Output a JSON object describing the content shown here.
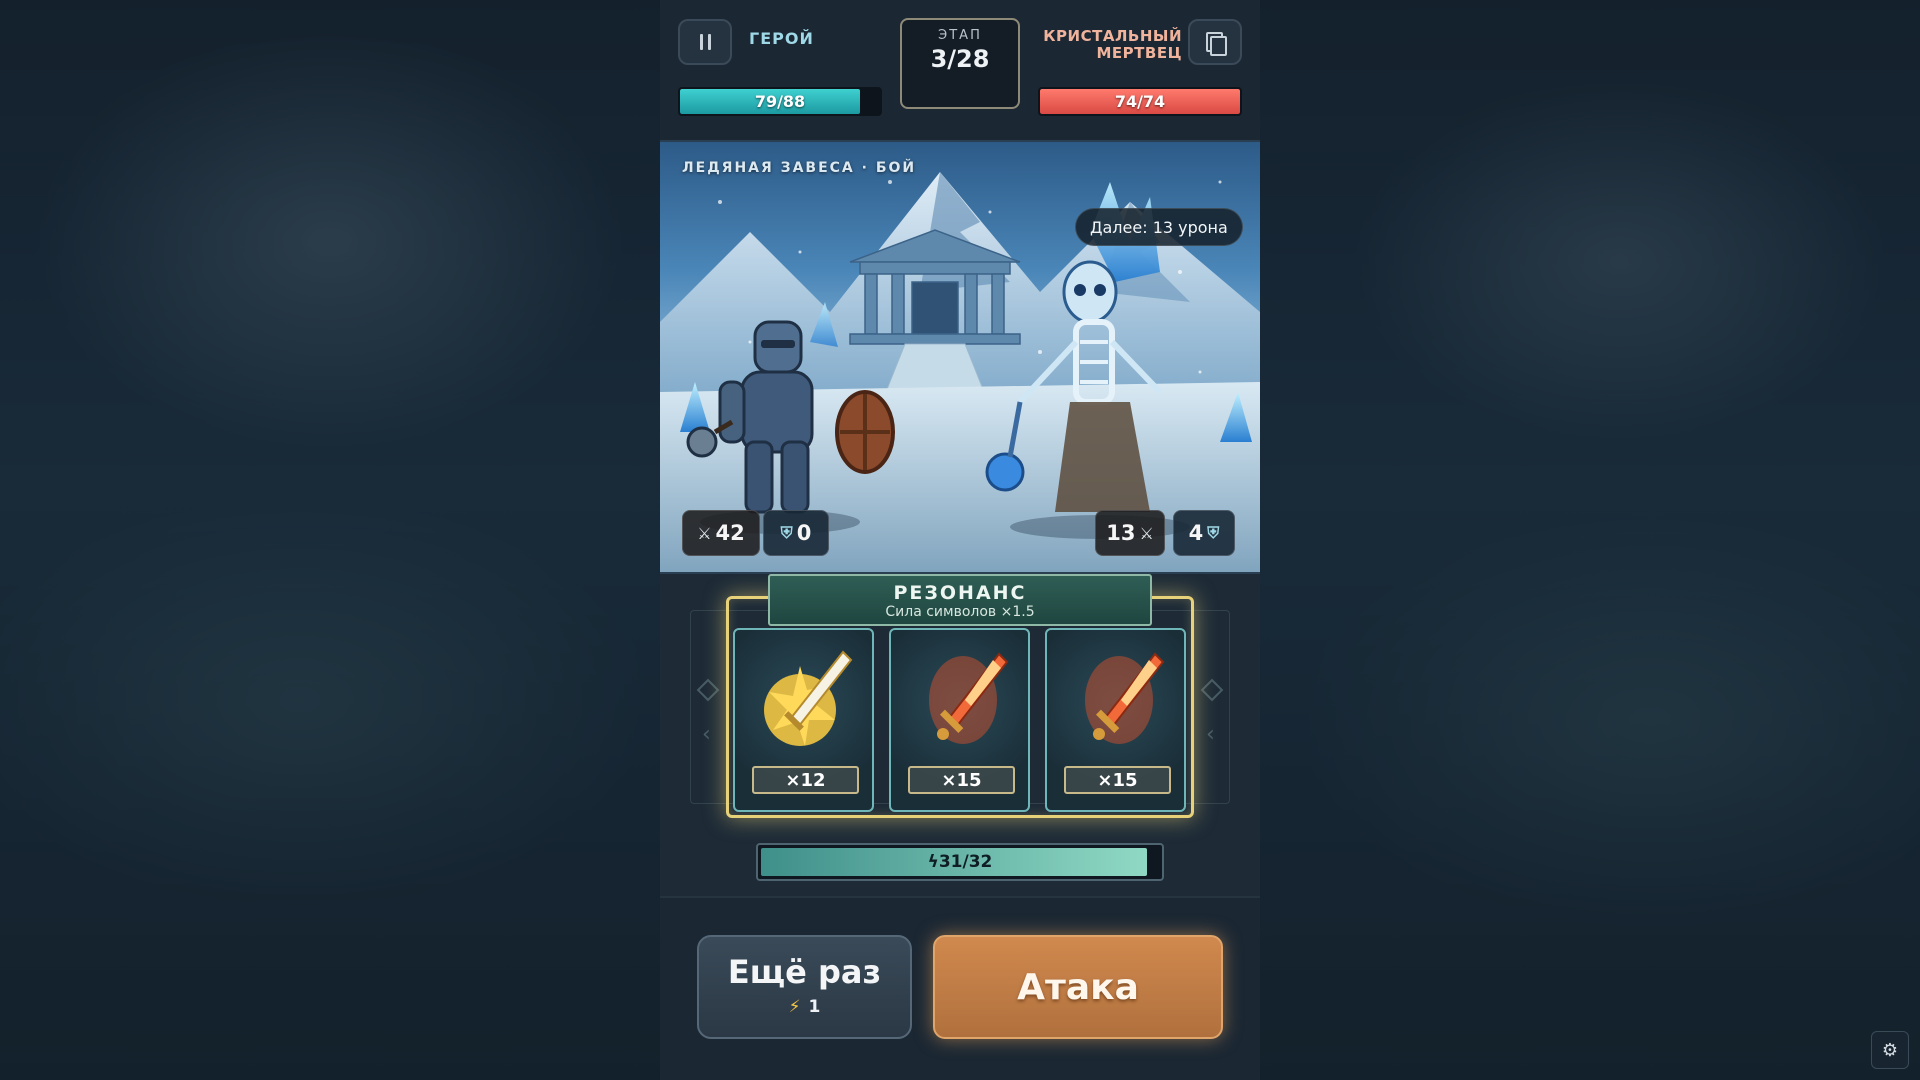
{
  "header": {
    "hero_name": "ГЕРОЙ",
    "enemy_name": "КРИСТАЛЬНЫЙ МЕРТВЕЦ",
    "stage_label": "ЭТАП",
    "stage_value": "3/28",
    "hero_hp": {
      "text": "79/88",
      "current": 79,
      "max": 88
    },
    "enemy_hp": {
      "text": "74/74",
      "current": 74,
      "max": 74
    },
    "pause_icon": "pause-icon",
    "deck_icon": "cards-icon"
  },
  "scene": {
    "title": "ЛЕДЯНАЯ ЗАВЕСА · БОЙ",
    "intent": "Далее: 13 урона",
    "hero_attack": "42",
    "hero_defense": "0",
    "enemy_attack": "13",
    "enemy_defense": "4"
  },
  "reels": {
    "title": "РЕЗОНАНС",
    "subtitle": "Сила символов ×1.5",
    "symbols": [
      {
        "icon": "holy-sword-icon",
        "multiplier": "×12"
      },
      {
        "icon": "fire-sword-icon",
        "multiplier": "×15"
      },
      {
        "icon": "fire-sword-icon",
        "multiplier": "×15"
      }
    ],
    "energy": {
      "text": "31/32",
      "current": 31,
      "max": 32
    }
  },
  "actions": {
    "respin_label": "Ещё раз",
    "respin_cost": "1",
    "attack_label": "Атака"
  },
  "colors": {
    "hero_hp": "#1c9aa1",
    "enemy_hp": "#d94a44",
    "reel_frame": "#e7d27a",
    "attack_button": "#c07c45"
  }
}
